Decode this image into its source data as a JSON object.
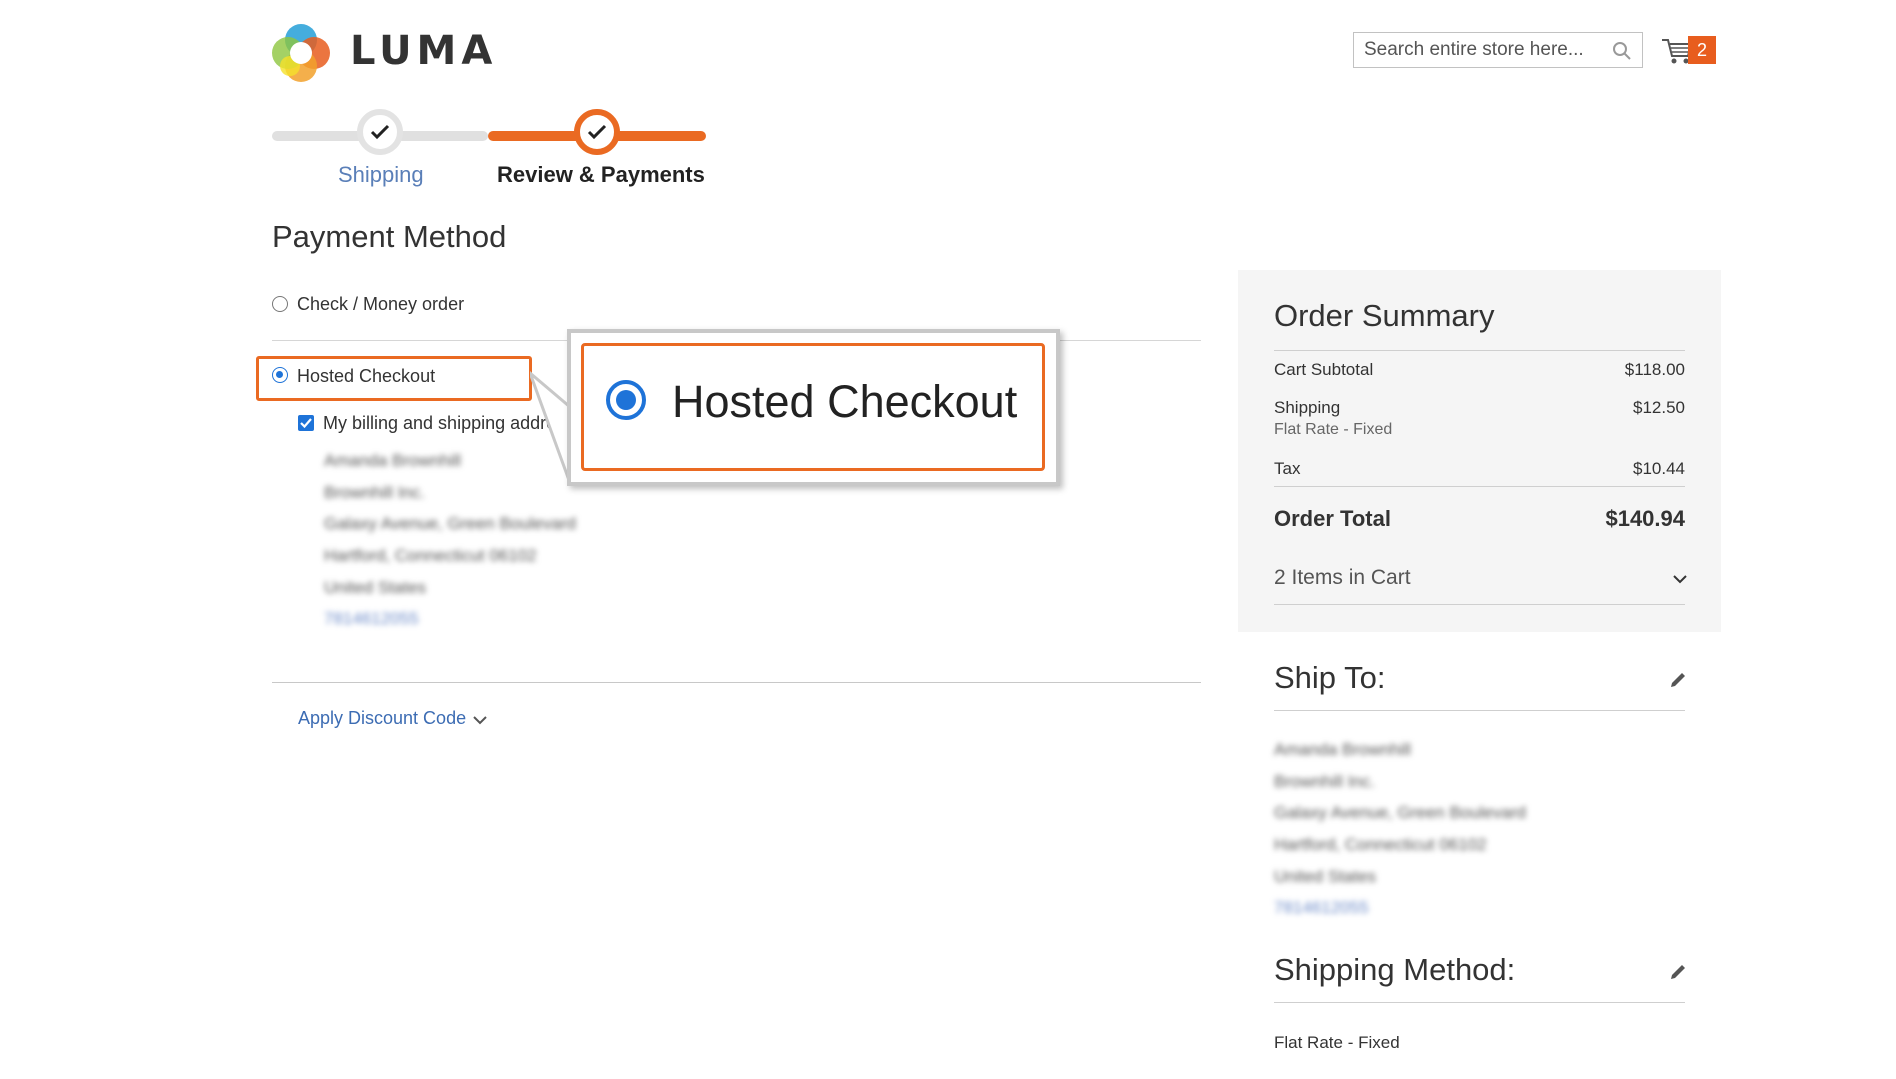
{
  "header": {
    "logo_text": "LUMA",
    "search_placeholder": "Search entire store here...",
    "cart_count": "2"
  },
  "progress": {
    "steps": [
      {
        "label": "Shipping",
        "state": "complete"
      },
      {
        "label": "Review & Payments",
        "state": "active"
      }
    ]
  },
  "payment": {
    "title": "Payment Method",
    "methods": [
      {
        "label": "Check / Money order",
        "selected": false
      },
      {
        "label": "Hosted Checkout",
        "selected": true
      }
    ],
    "billing_same_label": "My billing and shipping address",
    "billing_address": [
      "Amanda Brownhill",
      "Brownhill Inc.",
      "Galaxy Avenue, Green Boulevard",
      "Hartford, Connecticut 06102",
      "United States",
      "7814612055"
    ],
    "discount_label": "Apply Discount Code"
  },
  "callout": {
    "label": "Hosted Checkout"
  },
  "summary": {
    "title": "Order Summary",
    "rows": [
      {
        "label": "Cart Subtotal",
        "value": "$118.00"
      },
      {
        "label": "Shipping",
        "sub": "Flat Rate - Fixed",
        "value": "$12.50"
      },
      {
        "label": "Tax",
        "value": "$10.44"
      }
    ],
    "total_label": "Order Total",
    "total_value": "$140.94",
    "items_in_cart": "2 Items in Cart"
  },
  "ship_to": {
    "title": "Ship To:",
    "address": [
      "Amanda Brownhill",
      "Brownhill Inc.",
      "Galaxy Avenue, Green Boulevard",
      "Hartford, Connecticut 06102",
      "United States",
      "7814612055"
    ]
  },
  "shipping_method": {
    "title": "Shipping Method:",
    "value": "Flat Rate - Fixed"
  },
  "colors": {
    "accent": "#ea6a22",
    "link": "#3c6cb3",
    "radio": "#1e73d8"
  }
}
